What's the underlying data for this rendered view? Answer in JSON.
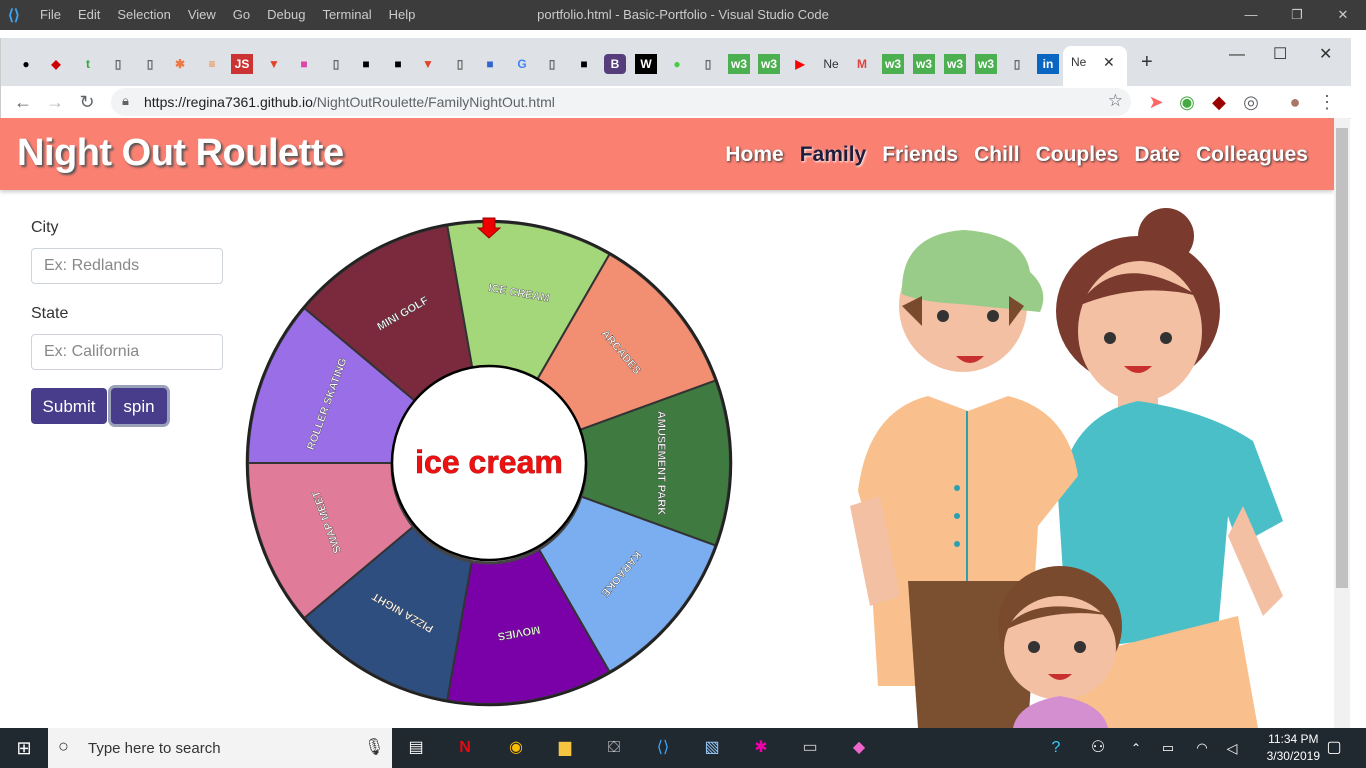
{
  "vscode": {
    "menu": [
      "File",
      "Edit",
      "Selection",
      "View",
      "Go",
      "Debug",
      "Terminal",
      "Help"
    ],
    "title": "portfolio.html - Basic-Portfolio - Visual Studio Code"
  },
  "browser": {
    "url_host": "https://regina7361.github.io",
    "url_path": "/NightOutRoulette/FamilyNightOut.html",
    "tab_labels": {
      "ne1": "Ne",
      "ne2": "Ne",
      "js": "JS",
      "t": "t",
      "b": "B",
      "w": "W"
    }
  },
  "site": {
    "brand": "Night Out Roulette",
    "nav": [
      "Home",
      "Family",
      "Friends",
      "Chill",
      "Couples",
      "Date",
      "Colleagues"
    ],
    "active_nav": "Family"
  },
  "form": {
    "city_label": "City",
    "city_placeholder": "Ex: Redlands",
    "state_label": "State",
    "state_placeholder": "Ex: California",
    "submit_label": "Submit",
    "spin_label": "spin"
  },
  "wheel": {
    "result": "ice cream",
    "segments": [
      {
        "label": "ICE CREAM",
        "color": "#a3d77a"
      },
      {
        "label": "ARCADES",
        "color": "#f28e72"
      },
      {
        "label": "AMUSEMENT PARK",
        "color": "#3f7b41"
      },
      {
        "label": "KARAOKE",
        "color": "#7baef0"
      },
      {
        "label": "MOVIES",
        "color": "#7a00a8"
      },
      {
        "label": "PIZZA NIGHT",
        "color": "#2e4e80"
      },
      {
        "label": "SWAP MEET",
        "color": "#e07c9a"
      },
      {
        "label": "ROLLER SKATING",
        "color": "#9a6ee6"
      },
      {
        "label": "MINI GOLF",
        "color": "#7b2a3e"
      }
    ]
  },
  "taskbar": {
    "search_placeholder": "Type here to search",
    "time": "11:34 PM",
    "date": "3/30/2019"
  }
}
